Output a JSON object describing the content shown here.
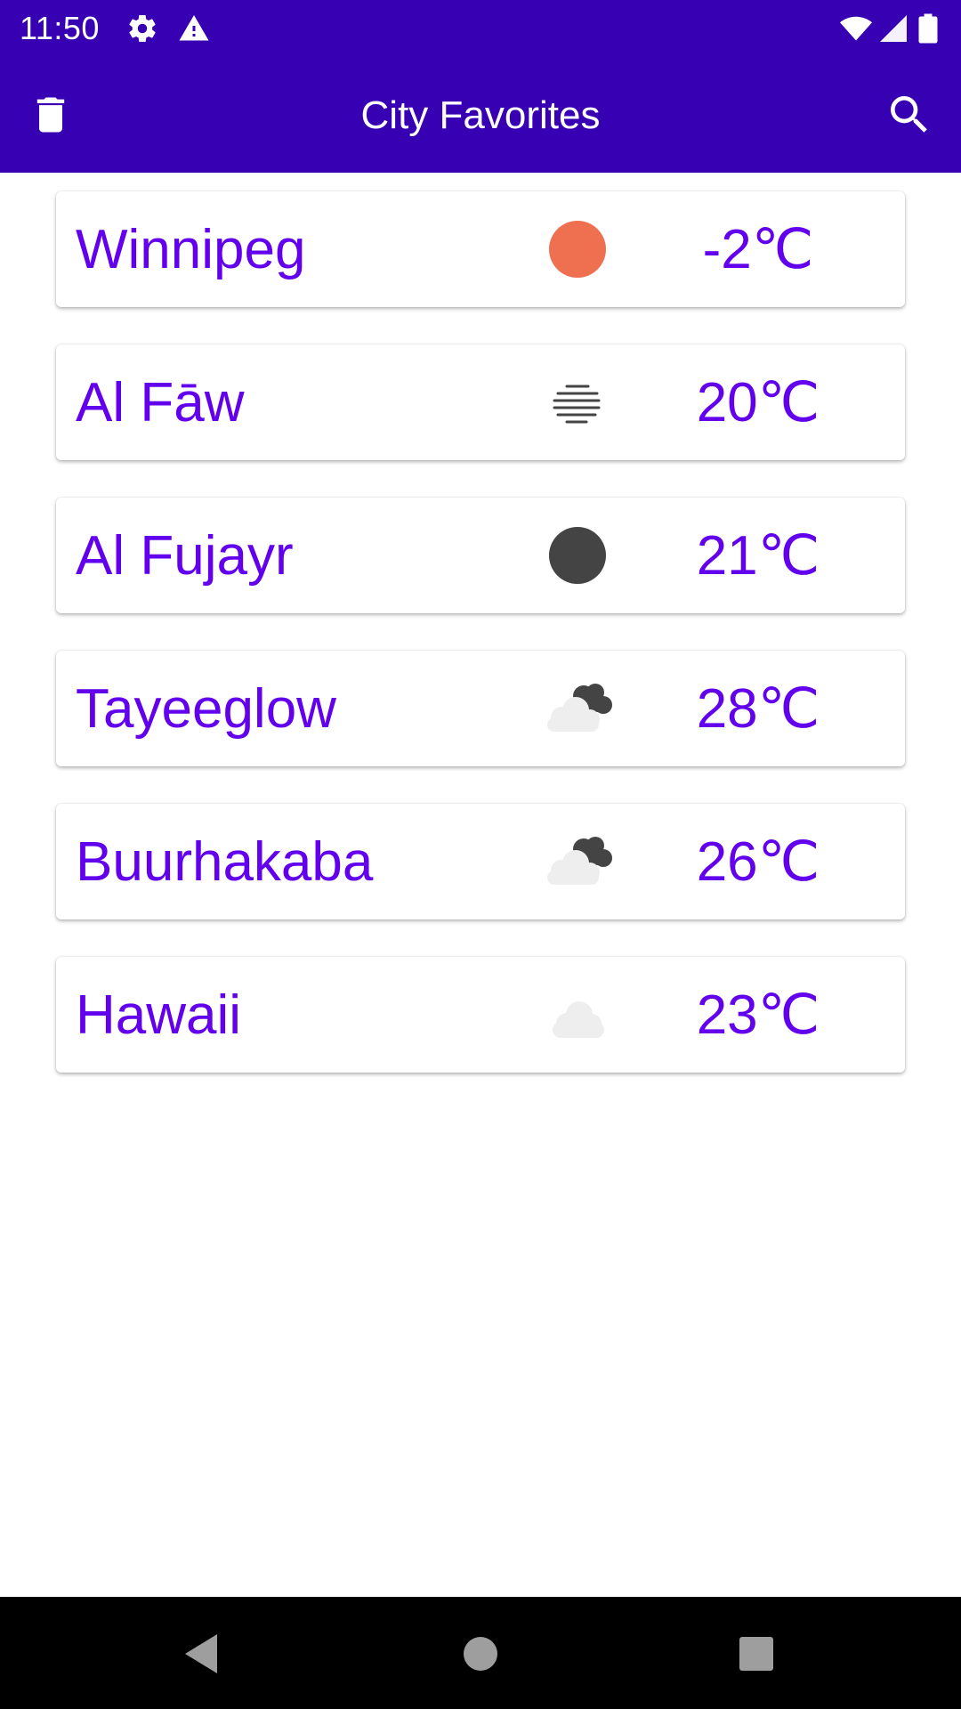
{
  "status_bar": {
    "time": "11:50",
    "left_icons": [
      "gear-icon",
      "warning-icon"
    ],
    "right_icons": [
      "wifi-icon",
      "cell-signal-icon",
      "battery-icon"
    ]
  },
  "toolbar": {
    "title": "City Favorites",
    "left_icon": "trash-icon",
    "right_icon": "search-icon",
    "background": "#3700b3"
  },
  "cities": [
    {
      "name": "Winnipeg",
      "temp": "-2℃",
      "weather_icon": "sun-icon"
    },
    {
      "name": "Al Fāw",
      "temp": "20℃",
      "weather_icon": "haze-icon"
    },
    {
      "name": "Al Fujayr",
      "temp": "21℃",
      "weather_icon": "clear-night-icon"
    },
    {
      "name": "Tayeeglow",
      "temp": "28℃",
      "weather_icon": "broken-clouds-icon"
    },
    {
      "name": "Buurhakaba",
      "temp": "26℃",
      "weather_icon": "broken-clouds-icon"
    },
    {
      "name": "Hawaii",
      "temp": "23℃",
      "weather_icon": "cloud-icon"
    }
  ],
  "colors": {
    "accent": "#6200ee",
    "status_bar": "#3700b3",
    "sun": "#ee7051",
    "moon": "#444444"
  },
  "nav_bar": {
    "icons": [
      "back-icon",
      "home-icon",
      "recents-icon"
    ]
  }
}
